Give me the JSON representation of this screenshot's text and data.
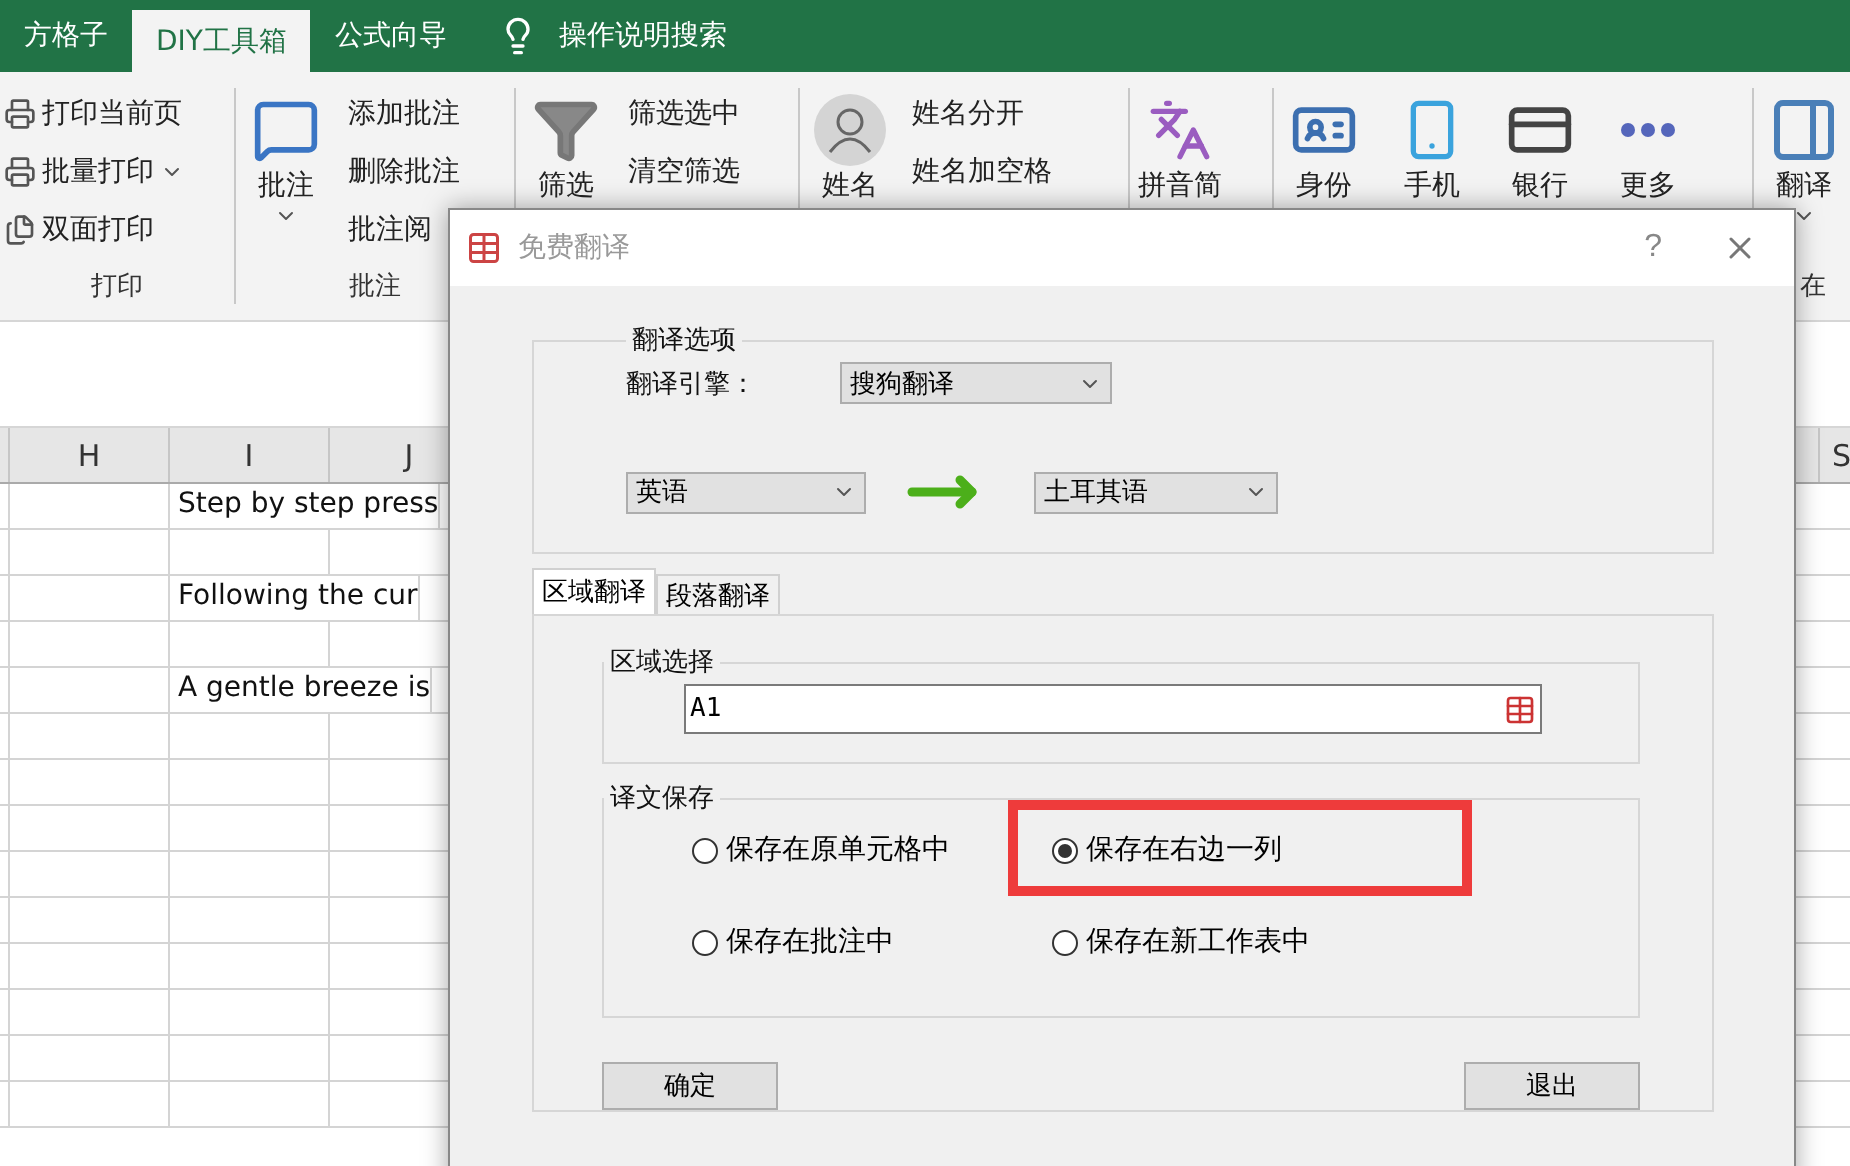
{
  "ribbon_tabs": [
    {
      "label": "方格子",
      "selected": false
    },
    {
      "label": "DIY工具箱",
      "selected": true
    },
    {
      "label": "公式向导",
      "selected": false
    }
  ],
  "tell_me": {
    "label": "操作说明搜索"
  },
  "ribbon_groups": [
    {
      "title": "打印",
      "items": [
        {
          "kind": "small",
          "label": "打印当前页"
        },
        {
          "kind": "small",
          "label": "批量打印",
          "dropdown": true
        },
        {
          "kind": "small",
          "label": "双面打印"
        }
      ]
    },
    {
      "title": "批注",
      "items": [
        {
          "kind": "large",
          "label": "批注",
          "dropdown": true
        },
        {
          "kind": "small",
          "label": "添加批注"
        },
        {
          "kind": "small",
          "label": "删除批注"
        },
        {
          "kind": "small",
          "label": "批注阅"
        }
      ]
    },
    {
      "items": [
        {
          "kind": "large",
          "label": "筛选"
        },
        {
          "kind": "small",
          "label": "筛选选中"
        },
        {
          "kind": "small",
          "label": "清空筛选"
        }
      ]
    },
    {
      "items": [
        {
          "kind": "large",
          "label": "姓名"
        },
        {
          "kind": "small",
          "label": "姓名分开"
        },
        {
          "kind": "small",
          "label": "姓名加空格"
        }
      ]
    },
    {
      "items": [
        {
          "kind": "large",
          "label": "拼音简"
        }
      ]
    },
    {
      "items": [
        {
          "kind": "large",
          "label": "身份"
        },
        {
          "kind": "large",
          "label": "手机"
        },
        {
          "kind": "large",
          "label": "银行"
        },
        {
          "kind": "large",
          "label": "更多"
        }
      ]
    },
    {
      "title": "在",
      "items": [
        {
          "kind": "large",
          "label": "翻译",
          "dropdown": true
        }
      ]
    }
  ],
  "sheet": {
    "columns": [
      "H",
      "I",
      "J"
    ],
    "far_column": "S",
    "cells": [
      {
        "text": "Step by step press"
      },
      {
        "text": "Following the cur"
      },
      {
        "text": "A gentle breeze is"
      }
    ]
  },
  "dialog": {
    "title": "免费翻译",
    "help": "?",
    "options_group": {
      "title": "翻译选项",
      "engine_label": "翻译引擎：",
      "engine": "搜狗翻译",
      "source": "英语",
      "target": "土耳其语"
    },
    "tabs": [
      {
        "label": "区域翻译",
        "selected": true
      },
      {
        "label": "段落翻译",
        "selected": false
      }
    ],
    "range_group": {
      "title": "区域选择",
      "value": "A1"
    },
    "save_group": {
      "title": "译文保存",
      "options": [
        {
          "label": "保存在原单元格中",
          "selected": false
        },
        {
          "label": "保存在右边一列",
          "selected": true,
          "highlighted": true
        },
        {
          "label": "保存在批注中",
          "selected": false
        },
        {
          "label": "保存在新工作表中",
          "selected": false
        }
      ]
    },
    "buttons": [
      "确定",
      "退出"
    ]
  }
}
